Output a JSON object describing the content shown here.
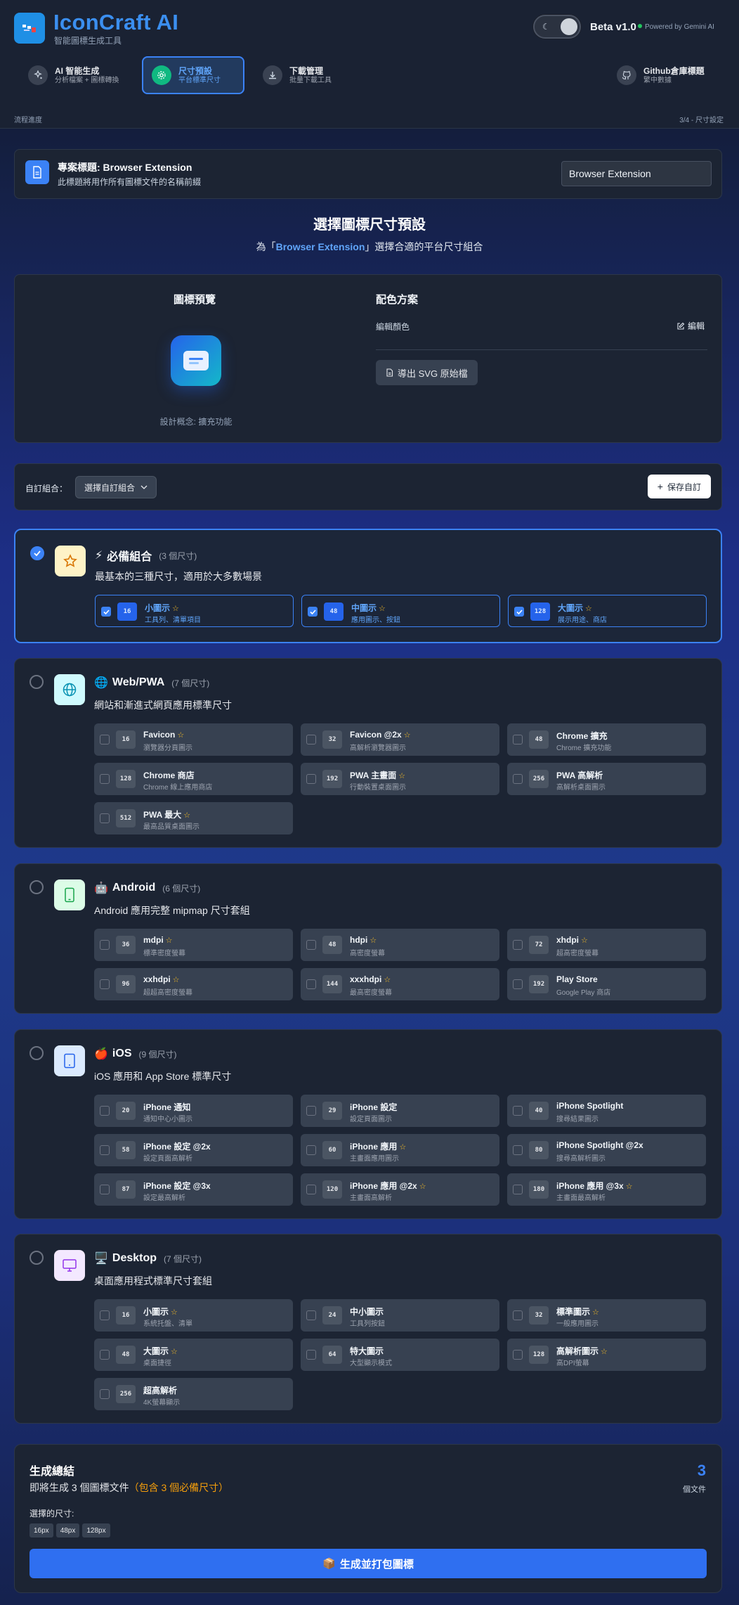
{
  "app": {
    "title": "IconCraft AI",
    "subtitle": "智能圖標生成工具",
    "version": "Beta v1.0",
    "powered": "Powered by Gemini AI"
  },
  "nav": [
    {
      "title": "AI 智能生成",
      "sub": "分析檔案 + 圖標轉換"
    },
    {
      "title": "尺寸預設",
      "sub": "平台標準尺寸"
    },
    {
      "title": "下載管理",
      "sub": "批量下載工具"
    },
    {
      "title": "Github倉庫標題",
      "sub": "繁中數據"
    }
  ],
  "progress": {
    "label": "流程進度",
    "step": "3/4 - 尺寸設定"
  },
  "project": {
    "title": "專案標題: Browser Extension",
    "desc": "此標題將用作所有圖標文件的名稱前綴",
    "value": "Browser Extension"
  },
  "section": {
    "title": "選擇圖標尺寸預設",
    "sub_pre": "為「",
    "sub_name": "Browser Extension",
    "sub_post": "」選擇合適的平台尺寸組合"
  },
  "preview": {
    "title": "圖標預覽",
    "concept": "設計概念: 擴充功能",
    "colors_title": "配色方案",
    "edit_colors": "編輯顏色",
    "edit": "編輯",
    "export_svg": "導出 SVG 原始檔"
  },
  "combo": {
    "label": "自訂組合：",
    "select": "選擇自訂組合",
    "save": "保存自訂"
  },
  "groups": [
    {
      "title": "必備組合",
      "count": "(3 個尺寸)",
      "desc": "最基本的三種尺寸，適用於大多數場景",
      "icon": "star-icon",
      "emoji": "⚡",
      "selected": true,
      "items": [
        {
          "px": "16",
          "name": "小圖示",
          "desc": "工具列、清單項目",
          "star": true,
          "on": true
        },
        {
          "px": "48",
          "name": "中圖示",
          "desc": "應用圖示、按鈕",
          "star": true,
          "on": true
        },
        {
          "px": "128",
          "name": "大圖示",
          "desc": "展示用途、商店",
          "star": true,
          "on": true
        }
      ]
    },
    {
      "title": "Web/PWA",
      "count": "(7 個尺寸)",
      "desc": "網站和漸進式網頁應用標準尺寸",
      "icon": "globe-icon",
      "emoji": "🌐",
      "selected": false,
      "items": [
        {
          "px": "16",
          "name": "Favicon",
          "desc": "瀏覽器分頁圖示",
          "star": true
        },
        {
          "px": "32",
          "name": "Favicon @2x",
          "desc": "高解析瀏覽器圖示",
          "star": true
        },
        {
          "px": "48",
          "name": "Chrome 擴充",
          "desc": "Chrome 擴充功能",
          "star": false
        },
        {
          "px": "128",
          "name": "Chrome 商店",
          "desc": "Chrome 線上應用商店",
          "star": false
        },
        {
          "px": "192",
          "name": "PWA 主畫面",
          "desc": "行動裝置桌面圖示",
          "star": true
        },
        {
          "px": "256",
          "name": "PWA 高解析",
          "desc": "高解析桌面圖示",
          "star": false
        },
        {
          "px": "512",
          "name": "PWA 最大",
          "desc": "最高品質桌面圖示",
          "star": true
        }
      ]
    },
    {
      "title": "Android",
      "count": "(6 個尺寸)",
      "desc": "Android 應用完整 mipmap 尺寸套組",
      "icon": "phone-icon",
      "emoji": "🤖",
      "selected": false,
      "items": [
        {
          "px": "36",
          "name": "mdpi",
          "desc": "標準密度螢幕",
          "star": true
        },
        {
          "px": "48",
          "name": "hdpi",
          "desc": "高密度螢幕",
          "star": true
        },
        {
          "px": "72",
          "name": "xhdpi",
          "desc": "超高密度螢幕",
          "star": true
        },
        {
          "px": "96",
          "name": "xxhdpi",
          "desc": "超超高密度螢幕",
          "star": true
        },
        {
          "px": "144",
          "name": "xxxhdpi",
          "desc": "最高密度螢幕",
          "star": true
        },
        {
          "px": "192",
          "name": "Play Store",
          "desc": "Google Play 商店",
          "star": false
        }
      ]
    },
    {
      "title": "iOS",
      "count": "(9 個尺寸)",
      "desc": "iOS 應用和 App Store 標準尺寸",
      "icon": "tablet-icon",
      "emoji": "🍎",
      "selected": false,
      "items": [
        {
          "px": "20",
          "name": "iPhone 通知",
          "desc": "通知中心小圖示",
          "star": false
        },
        {
          "px": "29",
          "name": "iPhone 設定",
          "desc": "設定頁面圖示",
          "star": false
        },
        {
          "px": "40",
          "name": "iPhone Spotlight",
          "desc": "搜尋結果圖示",
          "star": false
        },
        {
          "px": "58",
          "name": "iPhone 設定 @2x",
          "desc": "設定頁面高解析",
          "star": false
        },
        {
          "px": "60",
          "name": "iPhone 應用",
          "desc": "主畫面應用圖示",
          "star": true
        },
        {
          "px": "80",
          "name": "iPhone Spotlight @2x",
          "desc": "搜尋高解析圖示",
          "star": false
        },
        {
          "px": "87",
          "name": "iPhone 設定 @3x",
          "desc": "設定最高解析",
          "star": false
        },
        {
          "px": "120",
          "name": "iPhone 應用 @2x",
          "desc": "主畫面高解析",
          "star": true
        },
        {
          "px": "180",
          "name": "iPhone 應用 @3x",
          "desc": "主畫面最高解析",
          "star": true
        }
      ]
    },
    {
      "title": "Desktop",
      "count": "(7 個尺寸)",
      "desc": "桌面應用程式標準尺寸套組",
      "icon": "monitor-icon",
      "emoji": "🖥️",
      "selected": false,
      "items": [
        {
          "px": "16",
          "name": "小圖示",
          "desc": "系統托盤、清單",
          "star": true
        },
        {
          "px": "24",
          "name": "中小圖示",
          "desc": "工具列按鈕",
          "star": false
        },
        {
          "px": "32",
          "name": "標準圖示",
          "desc": "一般應用圖示",
          "star": true
        },
        {
          "px": "48",
          "name": "大圖示",
          "desc": "桌面捷徑",
          "star": true
        },
        {
          "px": "64",
          "name": "特大圖示",
          "desc": "大型顯示模式",
          "star": false
        },
        {
          "px": "128",
          "name": "高解析圖示",
          "desc": "高DPI螢幕",
          "star": true
        },
        {
          "px": "256",
          "name": "超高解析",
          "desc": "4K螢幕顯示",
          "star": false
        }
      ]
    }
  ],
  "summary": {
    "title": "生成總結",
    "desc": "即將生成 3 個圖標文件",
    "desc_extra": "（包含 3 個必備尺寸）",
    "count": "3",
    "unit": "個文件",
    "selected_label": "選擇的尺寸:",
    "chips": [
      "16px",
      "48px",
      "128px"
    ],
    "generate": "生成並打包圖標",
    "generate_emoji": "📦"
  },
  "colors": {
    "accent": "#3b82f6",
    "star": "#fbbf24",
    "amber": "#f59e0b",
    "green": "#10b981"
  }
}
